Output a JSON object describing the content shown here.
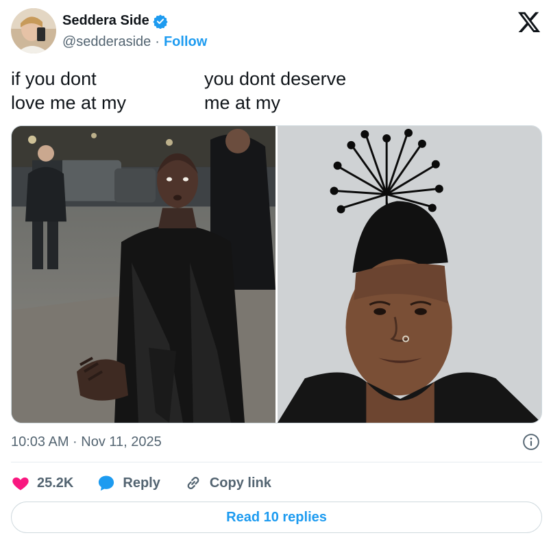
{
  "author": {
    "display_name": "Seddera Side",
    "handle": "@sedderaside",
    "separator": "·",
    "follow_label": "Follow",
    "verified": true,
    "verified_color": "#1d9bf0"
  },
  "tweet": {
    "text_left": [
      "if you dont",
      "love me at my"
    ],
    "text_right": [
      "you dont deserve",
      "me at my"
    ],
    "timestamp": "10:03 AM · Nov 11, 2025"
  },
  "media": {
    "left_icon": "photo-street-night",
    "right_icon": "photo-portrait-hat"
  },
  "actions": {
    "likes": "25.2K",
    "reply_label": "Reply",
    "copy_link_label": "Copy link",
    "like_color": "#f91880",
    "reply_color": "#1d9bf0"
  },
  "read_replies_label": "Read 10 replies",
  "colors": {
    "accent": "#1d9bf0",
    "text": "#0f1419",
    "secondary": "#536471"
  }
}
